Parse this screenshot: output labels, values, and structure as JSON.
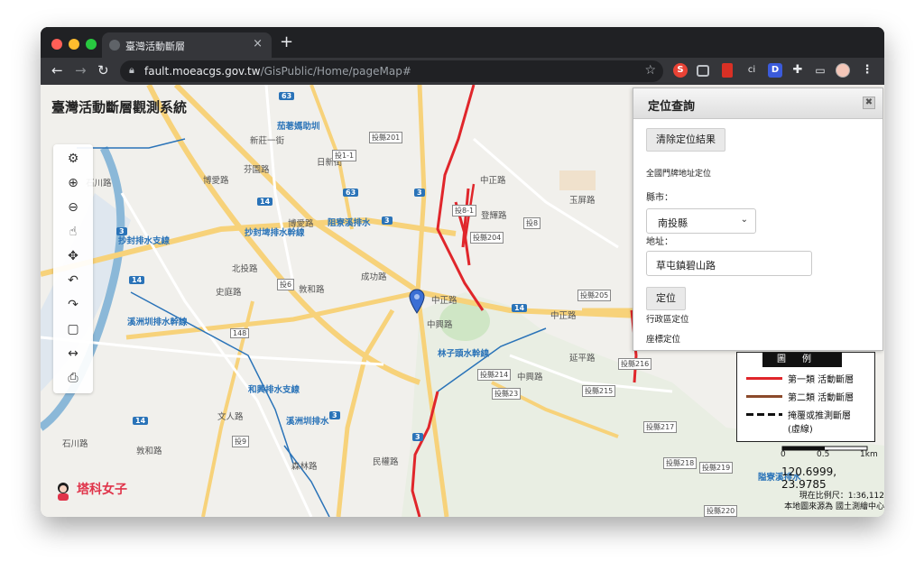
{
  "browser": {
    "tab_title": "臺灣活動斷層",
    "url_host": "fault.moeacgs.gov.tw",
    "url_path": "/GisPublic/Home/pageMap#",
    "extensions": [
      {
        "letter": "S",
        "color": "#e94235"
      },
      {
        "letter": "",
        "color": "#d93025"
      },
      {
        "letter": "ci",
        "color": "#35363a"
      },
      {
        "letter": "D",
        "color": "#3b5bdb"
      }
    ]
  },
  "map": {
    "title": "臺灣活動斷層觀測系統",
    "labels": [
      {
        "text": "新莊一街",
        "kind": "plain"
      },
      {
        "text": "石川路",
        "kind": "plain"
      },
      {
        "text": "博愛路",
        "kind": "plain"
      },
      {
        "text": "芬園路",
        "kind": "plain"
      },
      {
        "text": "日新街",
        "kind": "plain"
      },
      {
        "text": "投1-1",
        "kind": "shield"
      },
      {
        "text": "投縣201",
        "kind": "shield"
      },
      {
        "text": "中正路",
        "kind": "plain"
      },
      {
        "text": "投8-1",
        "kind": "shield"
      },
      {
        "text": "登輝路",
        "kind": "plain"
      },
      {
        "text": "投8",
        "kind": "shield"
      },
      {
        "text": "投縣204",
        "kind": "shield"
      },
      {
        "text": "玉屏路",
        "kind": "plain"
      },
      {
        "text": "抄封排水支線",
        "kind": "blue"
      },
      {
        "text": "抄封埤排水幹線",
        "kind": "blue"
      },
      {
        "text": "阻寮溪排水",
        "kind": "blue"
      },
      {
        "text": "博愛路",
        "kind": "plain"
      },
      {
        "text": "北投路",
        "kind": "plain"
      },
      {
        "text": "投6",
        "kind": "shield"
      },
      {
        "text": "敦和路",
        "kind": "plain"
      },
      {
        "text": "成功路",
        "kind": "plain"
      },
      {
        "text": "中正路",
        "kind": "plain"
      },
      {
        "text": "投縣205",
        "kind": "shield"
      },
      {
        "text": "中興路",
        "kind": "plain"
      },
      {
        "text": "史庭路",
        "kind": "plain"
      },
      {
        "text": "148",
        "kind": "shield"
      },
      {
        "text": "溪洲圳排水幹線",
        "kind": "blue"
      },
      {
        "text": "林子頭水幹線",
        "kind": "blue"
      },
      {
        "text": "投縣214",
        "kind": "shield"
      },
      {
        "text": "中興路",
        "kind": "plain"
      },
      {
        "text": "投縣23",
        "kind": "shield"
      },
      {
        "text": "延平路",
        "kind": "plain"
      },
      {
        "text": "和興排水支線",
        "kind": "blue"
      },
      {
        "text": "文人路",
        "kind": "plain"
      },
      {
        "text": "投9",
        "kind": "shield"
      },
      {
        "text": "溪洲圳排水",
        "kind": "blue"
      },
      {
        "text": "民權路",
        "kind": "plain"
      },
      {
        "text": "投縣217",
        "kind": "shield"
      },
      {
        "text": "投縣218",
        "kind": "shield"
      },
      {
        "text": "投縣219",
        "kind": "shield"
      },
      {
        "text": "石川路",
        "kind": "plain"
      },
      {
        "text": "敦和路",
        "kind": "plain"
      },
      {
        "text": "森林路",
        "kind": "plain"
      },
      {
        "text": "茄荖媽助圳",
        "kind": "blue"
      },
      {
        "text": "隘寮溪排水",
        "kind": "blue"
      },
      {
        "text": "中正路",
        "kind": "plain"
      },
      {
        "text": "投縣216",
        "kind": "shield"
      },
      {
        "text": "投縣215",
        "kind": "shield"
      },
      {
        "text": "投縣220",
        "kind": "shield"
      }
    ],
    "highways": [
      "63",
      "14",
      "3",
      "3",
      "63",
      "14",
      "14",
      "3",
      "14",
      "3",
      "3"
    ]
  },
  "tools": [
    {
      "name": "settings-gears-icon",
      "glyph": "⚙"
    },
    {
      "name": "zoom-in-icon",
      "glyph": "⊕"
    },
    {
      "name": "zoom-out-icon",
      "glyph": "⊖"
    },
    {
      "name": "pan-hand-icon",
      "glyph": "☝"
    },
    {
      "name": "move-arrows-icon",
      "glyph": "✥"
    },
    {
      "name": "undo-icon",
      "glyph": "↶"
    },
    {
      "name": "redo-icon",
      "glyph": "↷"
    },
    {
      "name": "full-extent-icon",
      "glyph": "▢"
    },
    {
      "name": "measure-icon",
      "glyph": "↔"
    },
    {
      "name": "print-icon",
      "glyph": "⎙"
    }
  ],
  "panel": {
    "title": "定位查詢",
    "clear_button": "清除定位結果",
    "section_address": "全國門牌地址定位",
    "county_label": "縣市：",
    "county_value": "南投縣",
    "address_label": "地址：",
    "address_value": "草屯鎮碧山路",
    "locate_button": "定位",
    "admin_link": "行政區定位",
    "coord_link": "座標定位"
  },
  "legend": {
    "title": "圖例",
    "rows": [
      {
        "label": "第一類 活動斷層",
        "color": "#e0262b",
        "style": "solid"
      },
      {
        "label": "第二類 活動斷層",
        "color": "#8b4a2b",
        "style": "solid"
      },
      {
        "label": "掩覆或推測斷層",
        "color": "#111111",
        "style": "dashed"
      },
      {
        "label": "(虛線)",
        "color": "",
        "style": "none"
      }
    ]
  },
  "scale": {
    "ticks": [
      "0",
      "0.5",
      "1km"
    ]
  },
  "coordinates": "120.6999, 23.9785",
  "current_scale": "現在比例尺：1:36,112",
  "map_source": "本地圖來源為 國土測繪中心",
  "watermark_text": "塔科女子",
  "colors": {
    "fault_primary": "#e0262b",
    "road_major": "#f7d27a",
    "water": "#2a73b8",
    "green_area": "#cfe6c5"
  }
}
